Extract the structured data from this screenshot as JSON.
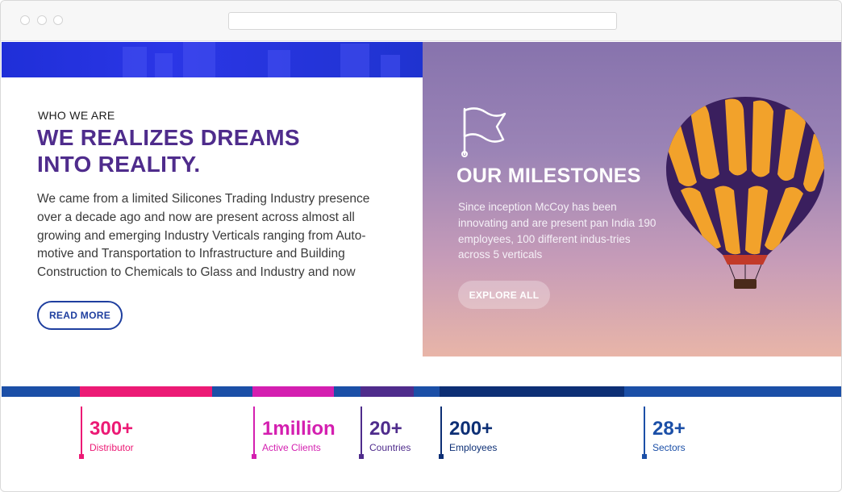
{
  "browser": {
    "url": ""
  },
  "about": {
    "eyebrow": "WHO WE ARE",
    "headline_line1": "WE REALIZES DREAMS",
    "headline_line2": "INTO REALITY.",
    "paragraph": "We came from a limited Silicones Trading Industry presence over a decade ago and now are present across almost all growing and emerging Industry Verticals ranging from Auto-motive and Transportation to Infrastructure and Building Construction to Chemicals to Glass and Industry and now",
    "read_more_label": "READ MORE"
  },
  "milestones": {
    "title": "OUR MILESTONES",
    "text": "Since inception McCoy has been innovating and are present pan India 190 employees, 100 different indus-tries across 5 verticals",
    "explore_label": "EXPLORE ALL",
    "icon": "flag-icon",
    "image": "hot-air-balloon"
  },
  "stats": [
    {
      "value": "300+",
      "label": "Distributor",
      "color": "#ec1a75"
    },
    {
      "value": "1million",
      "label": "Active Clients",
      "color": "#d41fb0"
    },
    {
      "value": "20+",
      "label": "Countries",
      "color": "#4f2c8c"
    },
    {
      "value": "200+",
      "label": "Employees",
      "color": "#0d2f75"
    },
    {
      "value": "28+",
      "label": "Sectors",
      "color": "#1b4fa7"
    }
  ],
  "colors": {
    "brand_purple": "#4f2c8c",
    "brand_blue": "#1f3f9f",
    "band_blue": "#1b4fa7",
    "pink": "#ec1a75",
    "magenta": "#d41fb0",
    "navy": "#0d2f75"
  }
}
